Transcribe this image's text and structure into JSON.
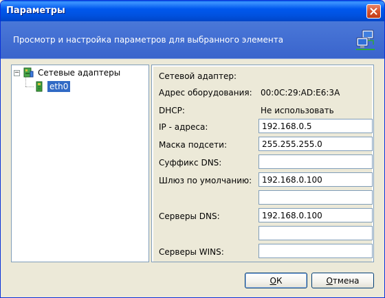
{
  "window": {
    "title": "Параметры",
    "header_text": "Просмотр и настройка параметров для выбранного элемента"
  },
  "tree": {
    "root_label": "Сетевые адаптеры",
    "expander_symbol": "−",
    "child_label": "eth0"
  },
  "props": {
    "adapter_label": "Сетевой адаптер:",
    "hw_label": "Адрес оборудования:",
    "hw_value": "00:0C:29:AD:E6:3A",
    "dhcp_label": "DHCP:",
    "dhcp_value": "Не использовать",
    "ip_label": "IP - адреса:",
    "ip_value": "192.168.0.5",
    "mask_label": "Маска подсети:",
    "mask_value": "255.255.255.0",
    "dns_suffix_label": "Суффикс DNS:",
    "dns_suffix_value": "",
    "gateway_label": "Шлюз по умолчанию:",
    "gateway_value": "192.168.0.100",
    "gateway_value_2": "",
    "dns_label": "Серверы DNS:",
    "dns_value": "192.168.0.100",
    "dns_value_2": "",
    "wins_label": "Серверы WINS:",
    "wins_value": ""
  },
  "buttons": {
    "ok_mnemonic": "О",
    "ok_rest": "К",
    "cancel_mnemonic": "О",
    "cancel_rest": "тмена"
  },
  "colors": {
    "titlebar": "#0058EE",
    "header_band": "#3A64CC",
    "selection": "#316AC5"
  }
}
